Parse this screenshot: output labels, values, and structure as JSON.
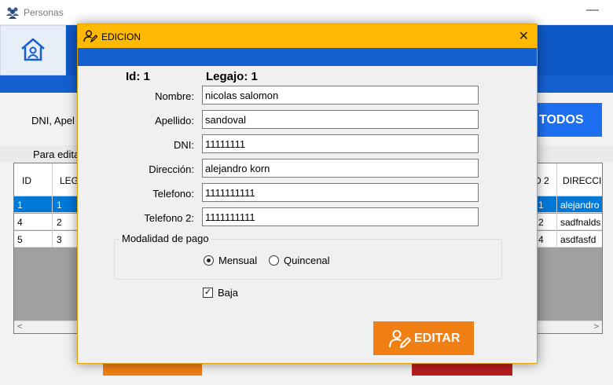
{
  "background_window": {
    "title": "Personas",
    "minimize_glyph": "—",
    "search_label": "DNI, Apel",
    "todos_button": "TODOS",
    "hint": "Para edita",
    "grid": {
      "headers": [
        "ID",
        "LEG",
        "D 2",
        "DIRECCI"
      ],
      "rows": [
        [
          "1",
          "1",
          "1",
          "alejandro"
        ],
        [
          "4",
          "2",
          "2",
          "sadfnalds"
        ],
        [
          "5",
          "3",
          "4",
          "asdfasfd"
        ]
      ]
    }
  },
  "dialog": {
    "title": "EDICION",
    "close_glyph": "✕",
    "id_label": "Id: 1",
    "legajo_label": "Legajo: 1",
    "fields": [
      {
        "label": "Nombre:",
        "value": "nicolas salomon"
      },
      {
        "label": "Apellido:",
        "value": "sandoval"
      },
      {
        "label": "DNI:",
        "value": "11111111"
      },
      {
        "label": "Dirección:",
        "value": "alejandro korn"
      },
      {
        "label": "Telefono:",
        "value": "1111111111"
      },
      {
        "label": "Telefono 2:",
        "value": "1111111111"
      }
    ],
    "payment_group": {
      "legend": "Modalidad de pago",
      "options": [
        {
          "label": "Mensual",
          "selected": true
        },
        {
          "label": "Quincenal",
          "selected": false
        }
      ]
    },
    "baja": {
      "label": "Baja",
      "checked": true,
      "glyph": "✓"
    },
    "edit_button": "EDITAR"
  },
  "colors": {
    "dialog_title": "#ffb900",
    "band_blue": "#1560d0",
    "edit_orange": "#f07f14",
    "todos_blue": "#1e6ff0",
    "delete_red": "#b81d1d"
  }
}
